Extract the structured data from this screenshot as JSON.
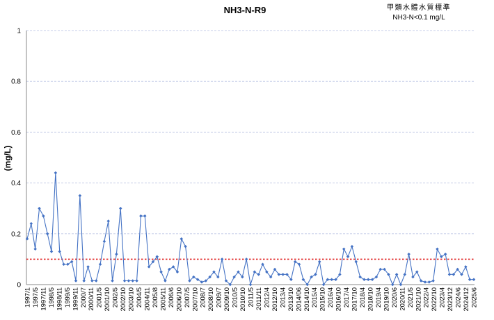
{
  "chart_data": {
    "type": "line",
    "title": "NH3-N-R9",
    "ylabel": "(mg/L)",
    "xlabel": "",
    "ylim": [
      0,
      1
    ],
    "yticks": [
      "0",
      "0.2",
      "0.4",
      "0.6",
      "0.8",
      "1"
    ],
    "yticks_values": [
      0,
      0.2,
      0.4,
      0.6,
      0.8,
      1
    ],
    "grid": true,
    "standard": {
      "title": "甲類水體水質標準",
      "label": "NH3-N<0.1 mg/L",
      "value": 0.1,
      "color": "#e02020"
    },
    "x_tick_labels": [
      "1997/1",
      "1997/5",
      "1997/11",
      "1998/5",
      "1998/11",
      "1999/5",
      "1999/11",
      "2000/7",
      "2000/11",
      "2001/5",
      "2001/10",
      "2002/5",
      "2002/10",
      "2003/10",
      "2004/5",
      "2004/11",
      "2005/8",
      "2005/11",
      "2006/6",
      "2006/10",
      "2007/5",
      "2007/10",
      "2008/7",
      "2008/10",
      "2009/7",
      "2009/10",
      "2010/5",
      "2010/10",
      "2011/5",
      "2011/11",
      "2012/4",
      "2012/10",
      "2013/4",
      "2013/10",
      "2014/06",
      "2014/10",
      "2015/4",
      "2015/10",
      "2016/4",
      "2016/10",
      "2017/4",
      "2017/10",
      "2018/4",
      "2018/10",
      "2019/4",
      "2019/10",
      "2020/6",
      "2020/11",
      "2021/5",
      "2021/10",
      "2022/4",
      "2022/10",
      "2023/4",
      "2023/12",
      "2024/6",
      "2024/12",
      "2025/6"
    ],
    "series": [
      {
        "color": "#4472c4",
        "values": [
          0.18,
          0.24,
          0.14,
          0.3,
          0.27,
          0.2,
          0.13,
          0.44,
          0.13,
          0.08,
          0.08,
          0.09,
          0.015,
          0.35,
          0.015,
          0.07,
          0.015,
          0.015,
          0.08,
          0.17,
          0.25,
          0.015,
          0.12,
          0.3,
          0.015,
          0.015,
          0.015,
          0.015,
          0.27,
          0.27,
          0.07,
          0.09,
          0.11,
          0.05,
          0.015,
          0.06,
          0.07,
          0.05,
          0.18,
          0.15,
          0.015,
          0.03,
          0.02,
          0.01,
          0.015,
          0.03,
          0.05,
          0.03,
          0.1,
          0.015,
          0.0,
          0.03,
          0.05,
          0.03,
          0.1,
          0.0,
          0.05,
          0.04,
          0.08,
          0.05,
          0.03,
          0.06,
          0.04,
          0.04,
          0.04,
          0.02,
          0.09,
          0.08,
          0.02,
          0.0,
          0.03,
          0.04,
          0.09,
          0.0,
          0.02,
          0.02,
          0.02,
          0.04,
          0.14,
          0.11,
          0.15,
          0.09,
          0.03,
          0.02,
          0.02,
          0.02,
          0.03,
          0.06,
          0.06,
          0.04,
          0.0,
          0.04,
          0.0,
          0.04,
          0.12,
          0.03,
          0.05,
          0.015,
          0.01,
          0.01,
          0.015,
          0.14,
          0.11,
          0.12,
          0.04,
          0.04,
          0.06,
          0.04,
          0.07,
          0.02,
          0.02
        ]
      }
    ]
  }
}
